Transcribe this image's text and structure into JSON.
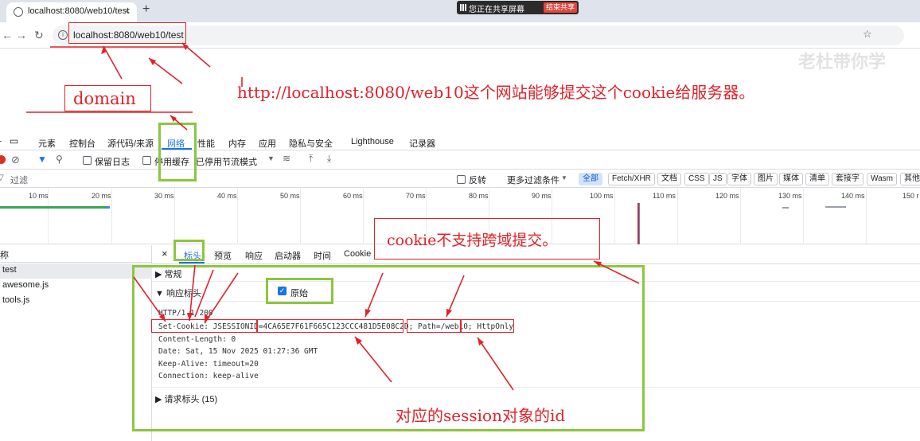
{
  "browser": {
    "tab_title": "localhost:8080/web10/test",
    "new_tab": "+",
    "close": "×",
    "share_text": "您正在共享屏幕",
    "stop_share": "结束共享",
    "url": "localhost:8080/web10/test",
    "watermark": "老杜带你学"
  },
  "annotations": {
    "domain_label": "domain",
    "url_note": "http://localhost:8080/web10这个网站能够提交这个cookie给服务器。",
    "cross_domain_note": "cookie不支持跨域提交。",
    "session_note": "对应的session对象的id"
  },
  "devtools": {
    "tabs": [
      "元素",
      "控制台",
      "源代码/来源",
      "网络",
      "性能",
      "内存",
      "应用",
      "隐私与安全",
      "Lighthouse",
      "记录器"
    ],
    "active_tab": "网络",
    "toolbar": {
      "preserve_log": "保留日志",
      "disable_cache": "停用缓存",
      "throttle": "已停用节流模式"
    },
    "filter": {
      "label": "过滤",
      "invert": "反转",
      "more_filters": "更多过滤条件",
      "chips": [
        "全部",
        "Fetch/XHR",
        "文档",
        "CSS",
        "JS",
        "字体",
        "图片",
        "媒体",
        "清单",
        "套接字",
        "Wasm",
        "其他"
      ],
      "active_chip": "全部"
    },
    "timeline_ticks": [
      "10 ms",
      "20 ms",
      "30 ms",
      "40 ms",
      "50 ms",
      "60 ms",
      "70 ms",
      "80 ms",
      "90 ms",
      "100 ms",
      "110 ms",
      "120 ms",
      "130 ms",
      "140 ms",
      "150 r"
    ],
    "requests": {
      "header": "称",
      "items": [
        "test",
        "awesome.js",
        "tools.js"
      ],
      "selected": "test"
    },
    "detail_tabs": [
      "标头",
      "预览",
      "响应",
      "启动器",
      "时间",
      "Cookie"
    ],
    "active_detail_tab": "标头",
    "sections": {
      "general": "▶ 常规",
      "response_headers": "▼ 响应标头",
      "raw_label": "原始",
      "request_headers": "▶ 请求标头 (15)"
    },
    "raw_lines": [
      "HTTP/1.1 200",
      "Set-Cookie: JSESSIONID=4CA65E7F61F665C123CCC481D5E08C2D; Path=/web10; HttpOnly",
      "Content-Length: 0",
      "Date: Sat, 15 Nov 2025 01:27:36 GMT",
      "Keep-Alive: timeout=20",
      "Connection: keep-alive"
    ]
  },
  "colors": {
    "annotation_red": "#e0232a",
    "annotation_green": "#8cc63f",
    "accent_blue": "#1a73e8"
  }
}
